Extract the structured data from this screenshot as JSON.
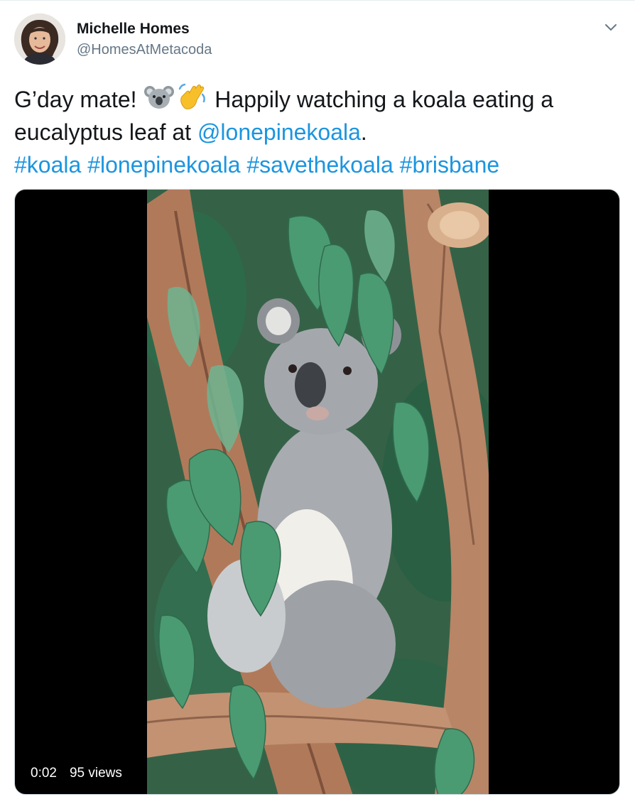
{
  "user": {
    "name": "Michelle Homes",
    "handle": "@HomesAtMetacoda",
    "avatar_icon": "profile-photo"
  },
  "tweet": {
    "text_part1": "G’day mate!",
    "emoji1": "koala-emoji",
    "emoji2": "waving-hand-emoji",
    "text_part2": "Happily watching a koala eating a eucalyptus leaf at",
    "mention": "@lonepinekoala",
    "text_part3": ".",
    "hashtags": [
      "#koala",
      "#lonepinekoala",
      "#savethekoala",
      "#brisbane"
    ]
  },
  "video": {
    "time": "0:02",
    "views": "95 views"
  },
  "colors": {
    "link": "#1b95e0",
    "secondary_text": "#657786",
    "leaf": "#3f8f6a",
    "bark": "#b88566",
    "koala_fur": "#a8abaf"
  }
}
